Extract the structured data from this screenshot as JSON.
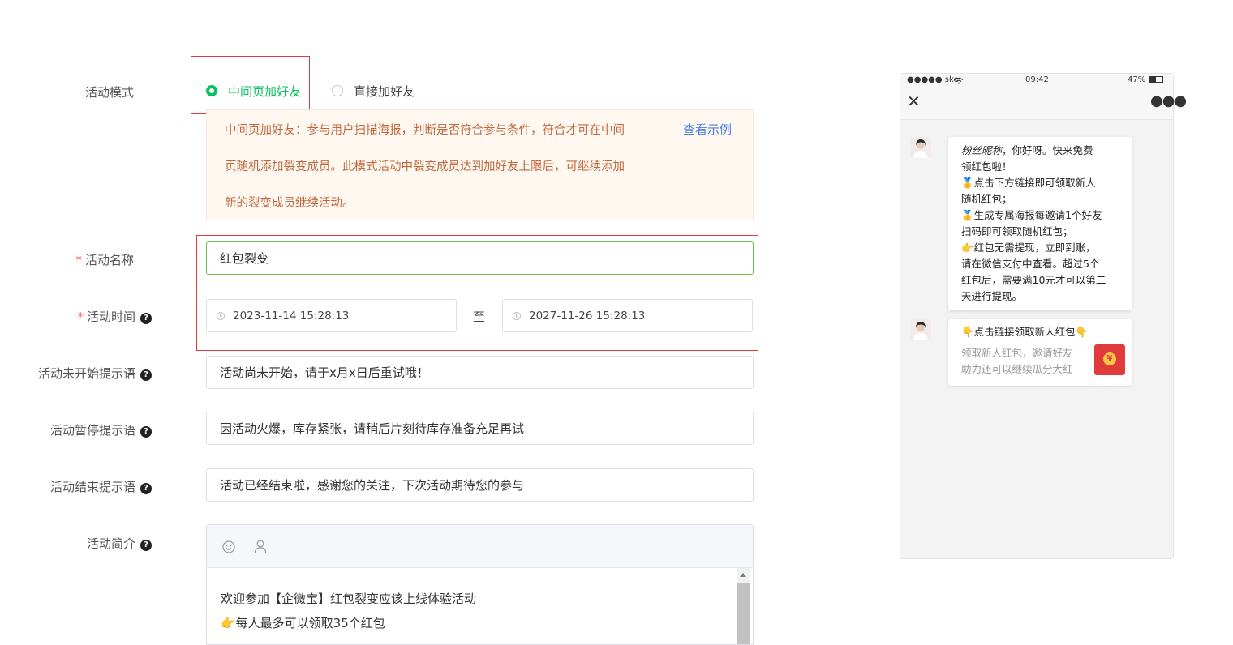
{
  "form": {
    "mode_label": "活动模式",
    "mode_options": [
      "中间页加好友",
      "直接加好友"
    ],
    "mode_hint_lines": [
      "中间页加好友：参与用户扫描海报，判断是否符合参与条件，符合才可在中间",
      "页随机添加裂变成员。此模式活动中裂变成员达到加好友上限后，可继续添加",
      "新的裂变成员继续活动。"
    ],
    "view_example": "查看示例",
    "name_label": "活动名称",
    "name_value": "红包裂变",
    "time_label": "活动时间",
    "time_start": "2023-11-14 15:28:13",
    "time_sep": "至",
    "time_end": "2027-11-26 15:28:13",
    "not_started_label": "活动未开始提示语",
    "not_started_value": "活动尚未开始，请于x月x日后重试哦！",
    "paused_label": "活动暂停提示语",
    "paused_value": "因活动火爆，库存紧张，请稍后片刻待库存准备充足再试",
    "ended_label": "活动结束提示语",
    "ended_value": "活动已经结束啦，感谢您的关注，下次活动期待您的参与",
    "intro_label": "活动简介",
    "intro_lines": [
      "欢迎参加【企微宝】红包裂变应该上线体验活动",
      "👉每人最多可以领取35个红包"
    ],
    "required_mark": "*",
    "help_mark": "?"
  },
  "phone": {
    "carrier": "●●●●● ske",
    "time": "09:42",
    "battery": "47%",
    "msg1_name": "粉丝昵称",
    "msg1_lines": [
      "，你好呀。快来免费",
      "领红包啦！",
      "🥇点击下方链接即可领取新人",
      "随机红包；",
      "🥇生成专属海报每邀请1个好友",
      "扫码即可领取随机红包；",
      "👉红包无需提现，立即到账，",
      "请在微信支付中查看。超过5个",
      "红包后，需要满10元才可以第二",
      "天进行提现。"
    ],
    "card_title": "👇点击链接领取新人红包👇",
    "card_desc_lines": [
      "领取新人红包，邀请好友",
      "助力还可以继续瓜分大红"
    ],
    "redpack_symbol": "¥"
  },
  "colors": {
    "primary": "#07c160",
    "link": "#4a7ee8",
    "hint": "#c0683c",
    "highlight": "#e0393e"
  }
}
